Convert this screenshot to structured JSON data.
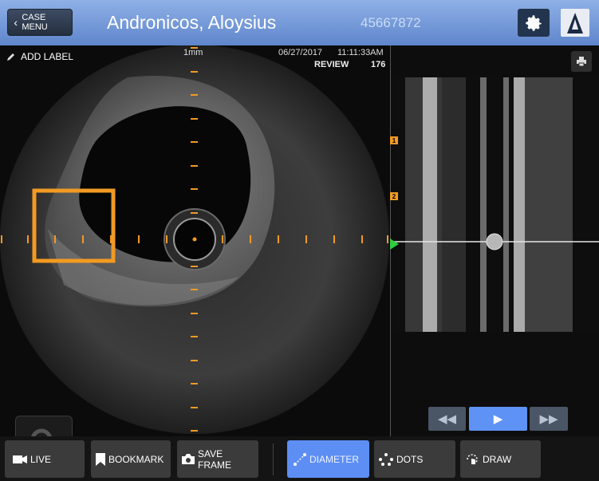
{
  "header": {
    "back_label": "CASE MENU",
    "patient_name": "Andronicos, Aloysius",
    "patient_id": "45667872",
    "settings_icon": "gear-icon",
    "logo_icon": "brand-logo"
  },
  "image": {
    "add_label": "ADD LABEL",
    "scale": "1mm",
    "date": "06/27/2017",
    "time": "11:11:33AM",
    "mode": "REVIEW",
    "frame": "176",
    "accent_color": "#f29a22"
  },
  "longitudinal": {
    "markers": [
      "1",
      "2"
    ],
    "transport": {
      "rewind": "◀◀",
      "play": "▶",
      "forward": "▶▶"
    }
  },
  "toolbar": {
    "live": "LIVE",
    "bookmark": "BOOKMARK",
    "save_frame": "SAVE FRAME",
    "diameter": "DIAMETER",
    "dots": "DOTS",
    "draw": "DRAW"
  }
}
